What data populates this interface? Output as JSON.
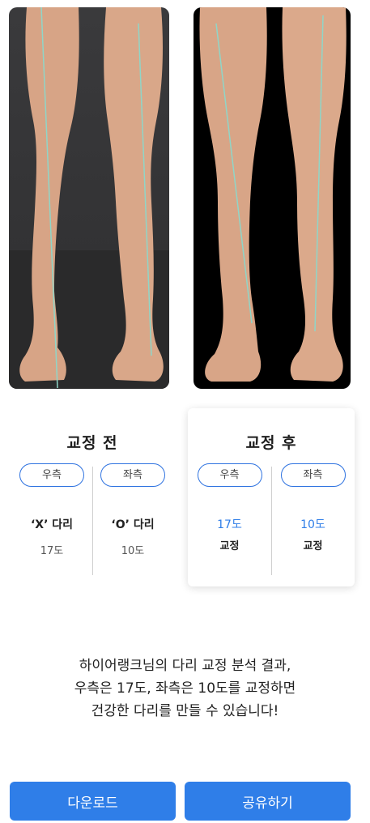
{
  "before": {
    "title": "교정 전",
    "right": {
      "tag": "우측",
      "line1": "‘X’ 다리",
      "line2": "17도"
    },
    "left": {
      "tag": "좌측",
      "line1": "‘O’ 다리",
      "line2": "10도"
    }
  },
  "after": {
    "title": "교정 후",
    "right": {
      "tag": "우측",
      "line1": "17도",
      "line2": "교정"
    },
    "left": {
      "tag": "좌측",
      "line1": "10도",
      "line2": "교정"
    }
  },
  "analysis": {
    "line1": "하이어랭크님의 다리 교정 분석 결과,",
    "line2": "우측은 17도, 좌측은 10도를 교정하면",
    "line3": "건강한 다리를 만들 수 있습니다!"
  },
  "buttons": {
    "download": "다운로드",
    "share": "공유하기"
  },
  "colors": {
    "accent": "#2f7ee8",
    "guide_line": "#8fd6c8"
  }
}
